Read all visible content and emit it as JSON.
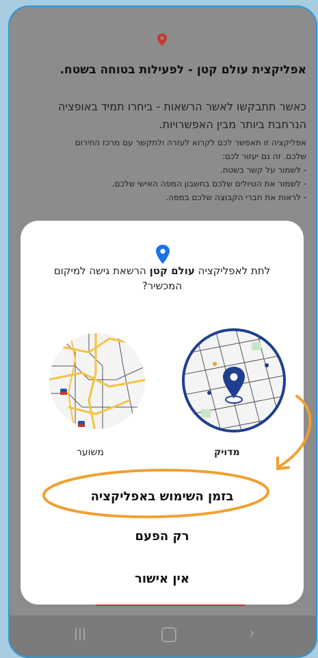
{
  "background_screen": {
    "title": "אפליקצית עולם קטן - לפעילות בטוחה בשטח.",
    "lead_lines": [
      "כאשר תתבקשו לאשר הרשאות - ביחרו תמיד באופציה",
      "הנרחבת ביותר מבין האפשרויות."
    ],
    "body_lines": [
      "אפליקציה זו תאפשר לכם לקרוא לעזרה ולתקשר עם מרכז החירום",
      "שלכם. זה גם יעזור לכם:",
      "- לשמור על קשר בשטח.",
      "- לשמור את הטיולים שלכם בחשבון המפה האישי שלכם.",
      "- לראות את חברי הקבוצה שלכם במפה."
    ]
  },
  "dialog": {
    "question_prefix": "לתת לאפליקציה ",
    "app_name": "עולם קטן",
    "question_suffix": " הרשאת גישה למיקום המכשיר?",
    "options": {
      "precise_label": "מדויק",
      "approximate_label": "משוער"
    },
    "buttons": {
      "while_using": "בזמן השימוש באפליקציה",
      "only_once": "רק הפעם",
      "deny": "אין אישור"
    }
  },
  "icons": {
    "top_pin": "location-pin-icon",
    "dialog_pin": "location-pin-icon",
    "nav_recents": "recents-icon",
    "nav_home": "home-icon",
    "nav_back": "back-icon"
  },
  "colors": {
    "frame_border": "#2d98d9",
    "overlay_bg": "#8c8c8c",
    "pin_red": "#c9372c",
    "pin_blue": "#1a73e8",
    "annotation_orange": "#f0a030",
    "precise_circle_border": "#1e3f8f"
  }
}
